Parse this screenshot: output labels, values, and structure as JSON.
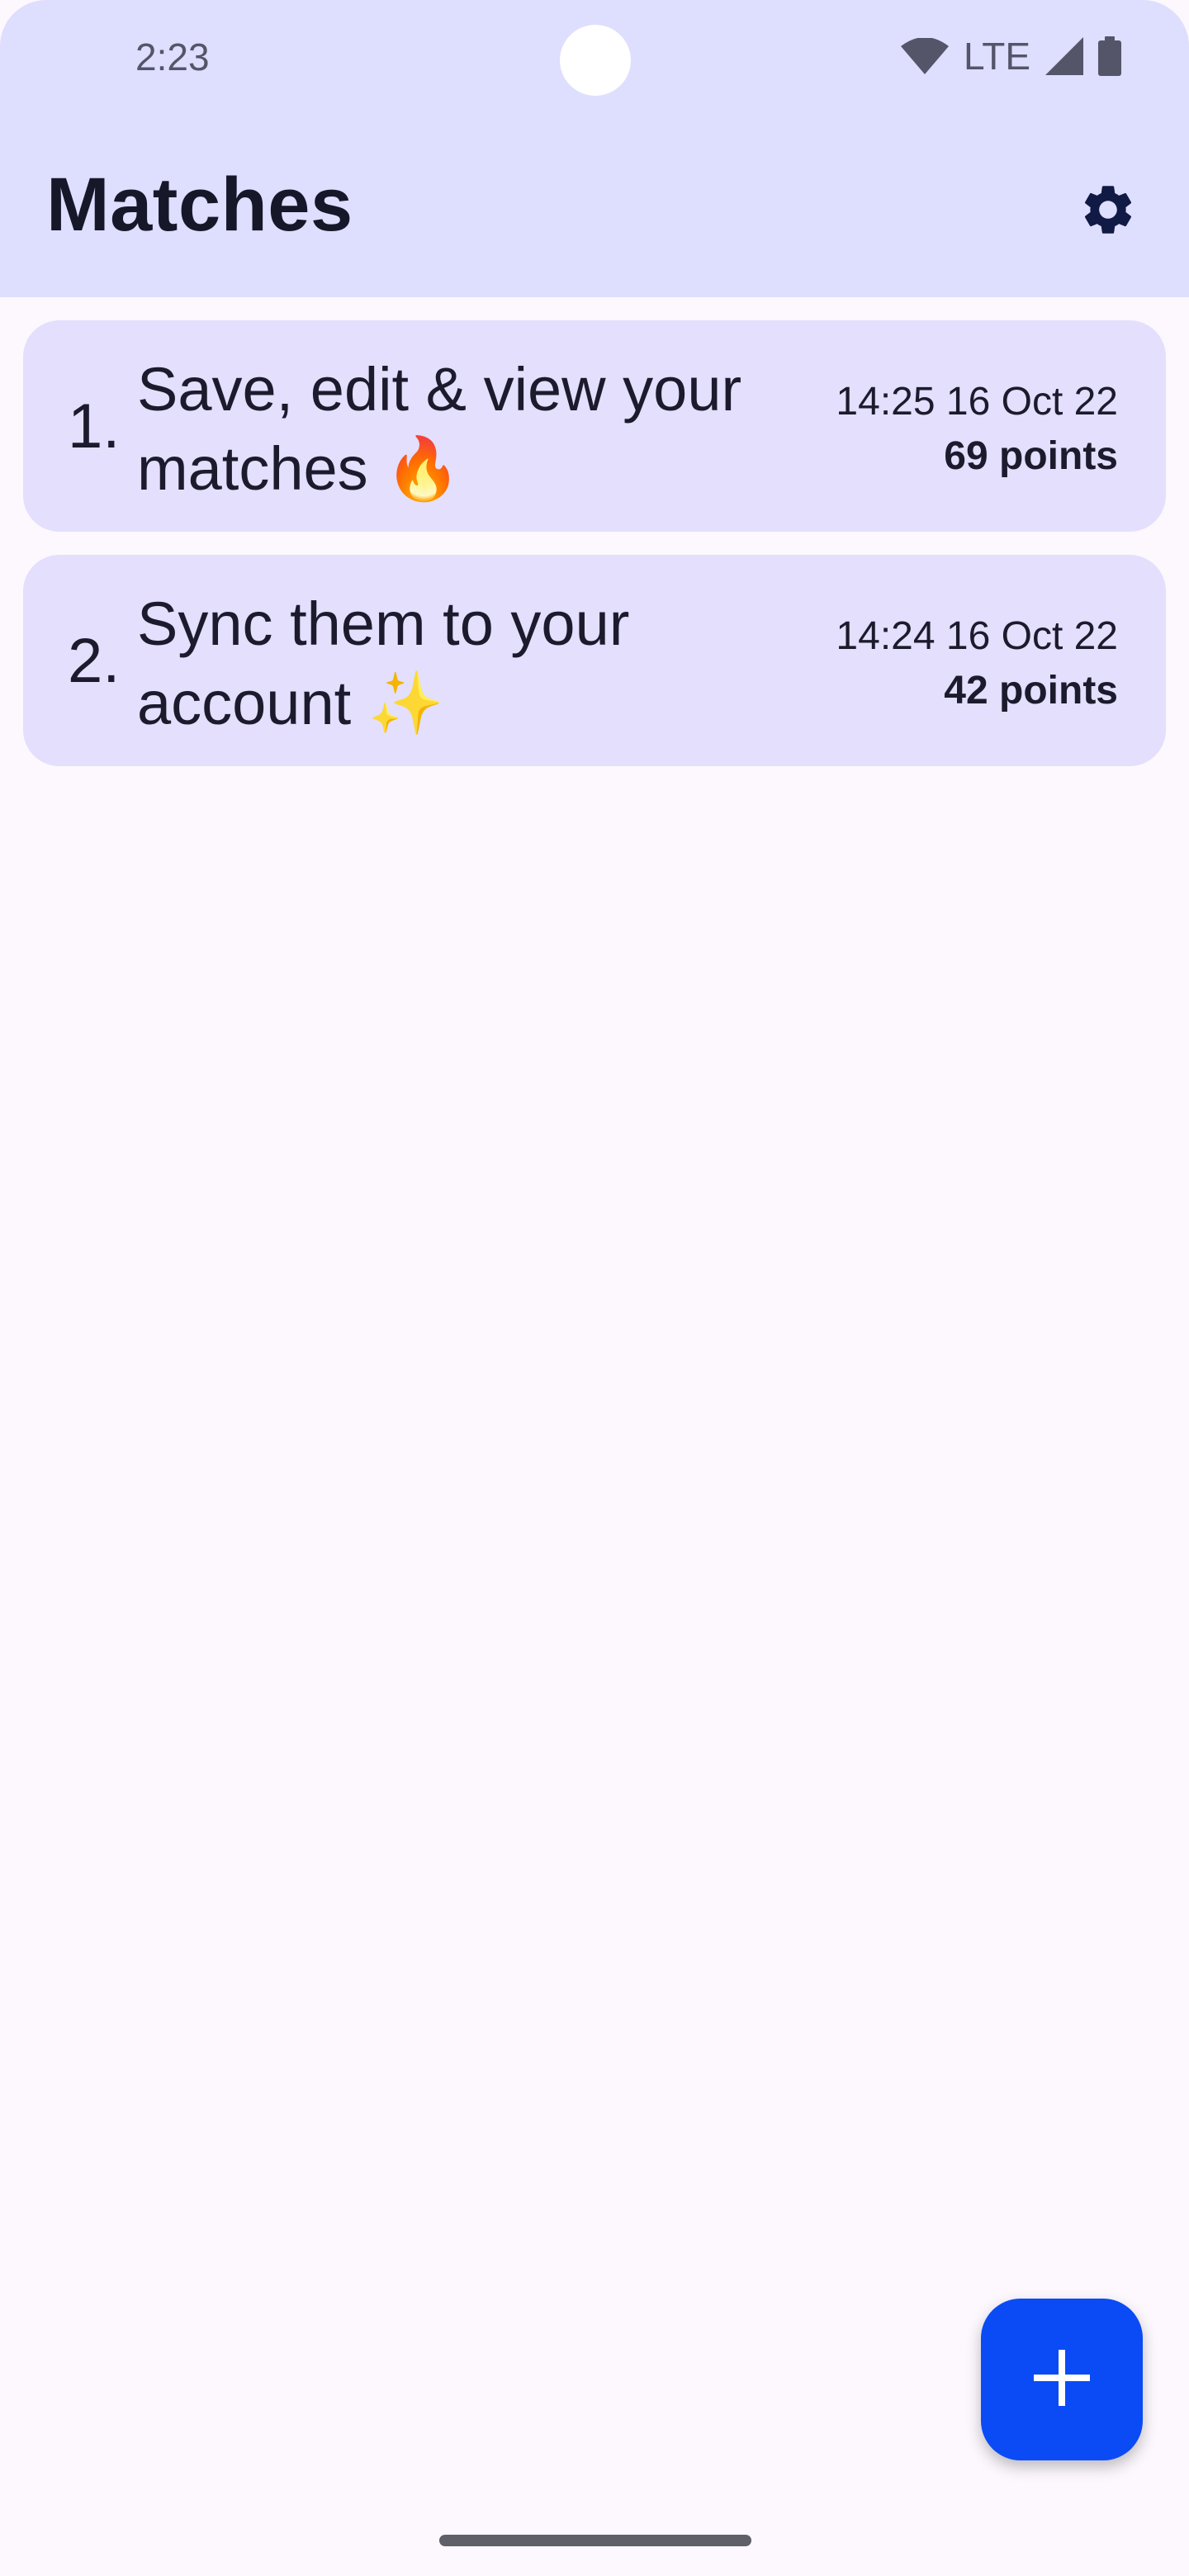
{
  "status_bar": {
    "time": "2:23",
    "network": "LTE",
    "icons": [
      "wifi-icon",
      "cellular-signal-icon",
      "battery-icon"
    ]
  },
  "app_bar": {
    "title": "Matches",
    "settings_icon": "gear-icon"
  },
  "matches": [
    {
      "number": "1.",
      "title": "Save, edit & view your matches 🔥",
      "timestamp": "14:25 16 Oct 22",
      "points": "69 points"
    },
    {
      "number": "2.",
      "title": "Sync them to your account ✨",
      "timestamp": "14:24 16 Oct 22",
      "points": "42 points"
    }
  ],
  "fab": {
    "icon": "plus-icon"
  },
  "colors": {
    "header_bg": "#DEDEFE",
    "card_bg": "#E3DFFC",
    "page_bg": "#FCF8FE",
    "fab_bg": "#0A4BF5",
    "text": "#1C1B2E"
  }
}
